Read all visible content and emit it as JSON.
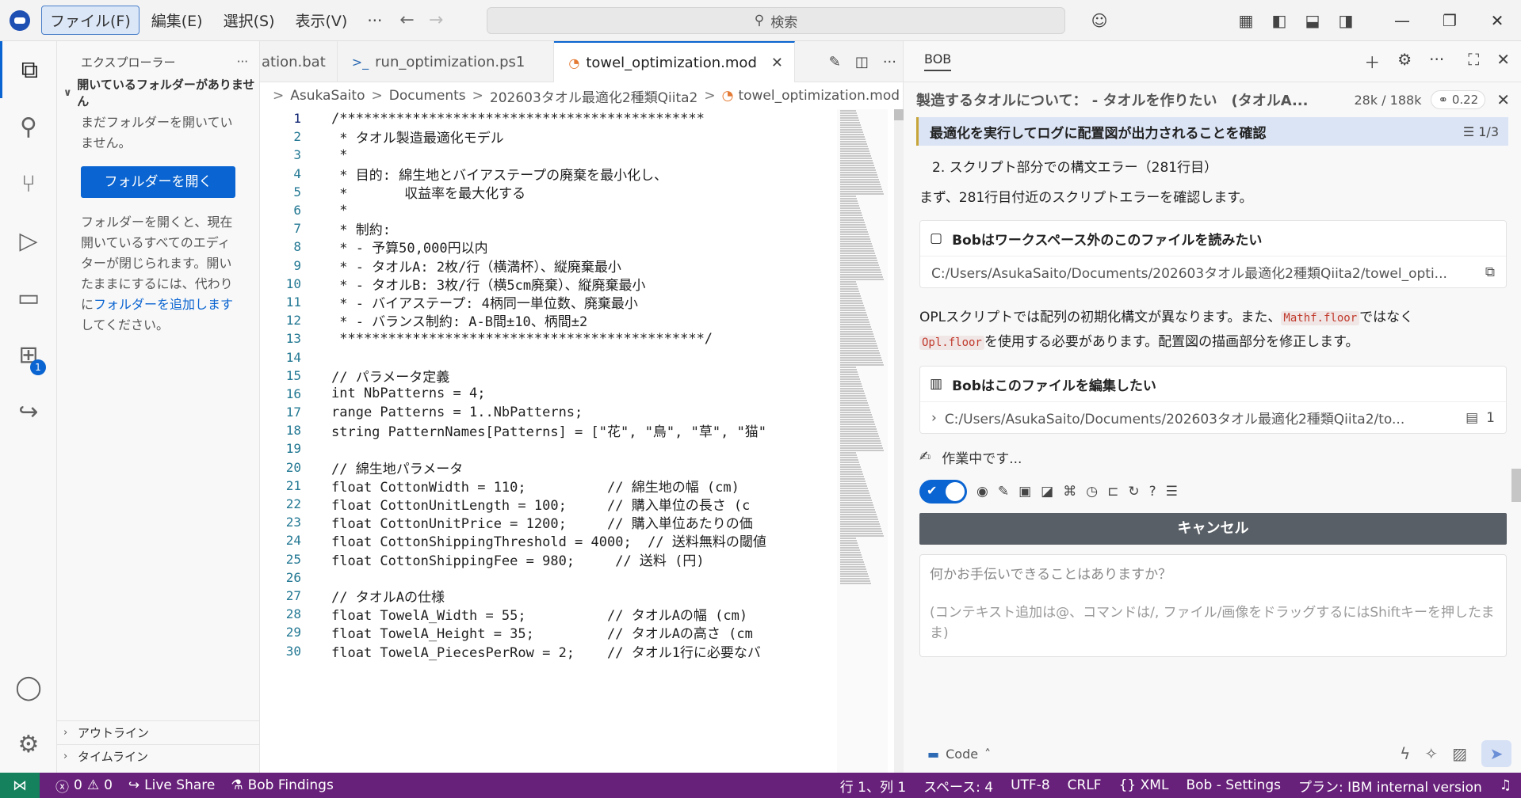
{
  "titlebar": {
    "menus": [
      "ファイル(F)",
      "編集(E)",
      "選択(S)",
      "表示(V)"
    ],
    "more": "···",
    "search_placeholder": "検索"
  },
  "sidebar": {
    "title": "エクスプローラー",
    "more": "···",
    "section_title": "開いているフォルダーがありません",
    "no_folder_text": "まだフォルダーを開いていません。",
    "open_folder_button": "フォルダーを開く",
    "info_text_1": "フォルダーを開くと、現在開いているすべてのエディターが閉じられます。開いたままにするには、代わりに",
    "info_link": "フォルダーを追加します",
    "info_text_2": "してください。",
    "outline_label": "アウトライン",
    "timeline_label": "タイムライン",
    "extensions_badge": "1"
  },
  "editor": {
    "tabs": [
      {
        "label": "ation.bat",
        "icon": "bat-icon"
      },
      {
        "label": "run_optimization.ps1",
        "icon": "powershell-icon"
      },
      {
        "label": "towel_optimization.mod",
        "icon": "rss-file-icon",
        "active": true
      }
    ],
    "breadcrumb": [
      "AsukaSaito",
      "Documents",
      "202603タオル最適化2種類Qiita2",
      "towel_optimization.mod"
    ],
    "lines": [
      {
        "n": "1",
        "text": "/*********************************************"
      },
      {
        "n": "2",
        "text": " * タオル製造最適化モデル"
      },
      {
        "n": "3",
        "text": " *"
      },
      {
        "n": "4",
        "text": " * 目的: 綿生地とバイアステープの廃棄を最小化し、"
      },
      {
        "n": "5",
        "text": " *       収益率を最大化する"
      },
      {
        "n": "6",
        "text": " *"
      },
      {
        "n": "7",
        "text": " * 制約:"
      },
      {
        "n": "8",
        "text": " * - 予算50,000円以内"
      },
      {
        "n": "9",
        "text": " * - タオルA: 2枚/行（横満杯）、縦廃棄最小"
      },
      {
        "n": "10",
        "text": " * - タオルB: 3枚/行（横5cm廃棄）、縦廃棄最小"
      },
      {
        "n": "11",
        "text": " * - バイアステープ: 4柄同一単位数、廃棄最小"
      },
      {
        "n": "12",
        "text": " * - バランス制約: A-B間±10、柄間±2"
      },
      {
        "n": "13",
        "text": " *********************************************/"
      },
      {
        "n": "14",
        "text": ""
      },
      {
        "n": "15",
        "text": "// パラメータ定義"
      },
      {
        "n": "16",
        "text": "int NbPatterns = 4;"
      },
      {
        "n": "17",
        "text": "range Patterns = 1..NbPatterns;"
      },
      {
        "n": "18",
        "text": "string PatternNames[Patterns] = [\"花\", \"鳥\", \"草\", \"猫\""
      },
      {
        "n": "19",
        "text": ""
      },
      {
        "n": "20",
        "text": "// 綿生地パラメータ"
      },
      {
        "n": "21",
        "text": "float CottonWidth = 110;          // 綿生地の幅 (cm)"
      },
      {
        "n": "22",
        "text": "float CottonUnitLength = 100;     // 購入単位の長さ (c"
      },
      {
        "n": "23",
        "text": "float CottonUnitPrice = 1200;     // 購入単位あたりの価"
      },
      {
        "n": "24",
        "text": "float CottonShippingThreshold = 4000;  // 送料無料の閾値"
      },
      {
        "n": "25",
        "text": "float CottonShippingFee = 980;     // 送料 (円)"
      },
      {
        "n": "26",
        "text": ""
      },
      {
        "n": "27",
        "text": "// タオルAの仕様"
      },
      {
        "n": "28",
        "text": "float TowelA_Width = 55;          // タオルAの幅 (cm)"
      },
      {
        "n": "29",
        "text": "float TowelA_Height = 35;         // タオルAの高さ (cm"
      },
      {
        "n": "30",
        "text": "float TowelA_PiecesPerRow = 2;    // タオル1行に必要なバ"
      }
    ]
  },
  "bob": {
    "panel_title": "BOB",
    "task_title": "製造するタオルについて： - タオルを作りたい　(タオルA...",
    "task_tokens": "28k / 188k",
    "task_cost": "0.22",
    "todo_text": "最適化を実行してログに配置図が出力されることを確認",
    "todo_count": "1/3",
    "msg_1": "2. スクリプト部分での構文エラー（281行目）",
    "msg_2": "まず、281行目付近のスクリプトエラーを確認します。",
    "read_card_title": "Bobはワークスペース外のこのファイルを読みたい",
    "read_card_path": "C:/Users/AsukaSaito/Documents/202603タオル最適化2種類Qiita2/towel_opti...",
    "msg_3a": "OPLスクリプトでは配列の初期化構文が異なります。また、",
    "msg_3_code1": "Mathf.floor",
    "msg_3b": "ではなく",
    "msg_3_code2": "Opl.floor",
    "msg_3c": "を使用する必要があります。配置図の描画部分を修正します。",
    "edit_card_title": "Bobはこのファイルを編集したい",
    "edit_card_path": "C:/Users/AsukaSaito/Documents/202603タオル最適化2種類Qiita2/to...",
    "edit_card_count": "1",
    "working_text": "作業中です...",
    "cancel_button": "キャンセル",
    "input_placeholder": "何かお手伝いできることはありますか？",
    "input_hint": "(コンテキスト追加は@、コマンドは/, ファイル/画像をドラッグするにはShiftキーを押したまま)",
    "mode_label": "Code"
  },
  "status": {
    "errors": "0",
    "warnings": "0",
    "live_share": "Live Share",
    "bob_findings": "Bob Findings",
    "position": "行 1、列 1",
    "spaces": "スペース: 4",
    "encoding": "UTF-8",
    "eol": "CRLF",
    "language": "XML",
    "settings": "Bob - Settings",
    "plan": "プラン: IBM internal version"
  },
  "colors": {
    "accent": "#0a64d1",
    "status_bar": "#68217a",
    "remote": "#16825d",
    "cancel": "#595f66"
  }
}
